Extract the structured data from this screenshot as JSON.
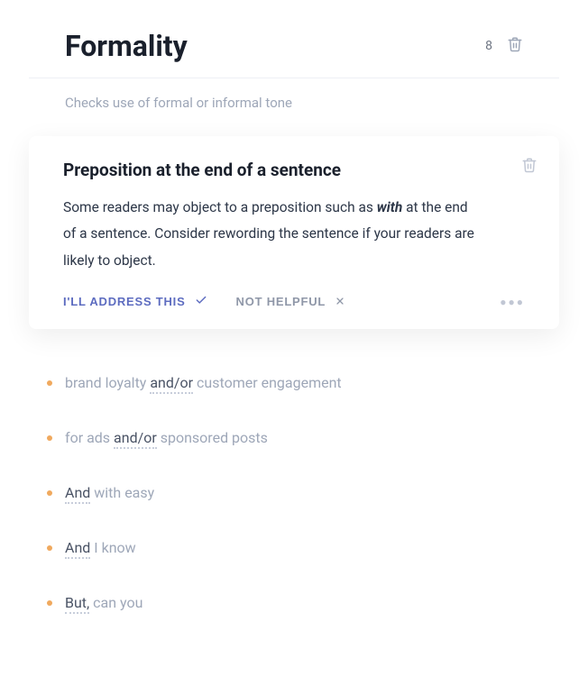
{
  "header": {
    "title": "Formality",
    "count": "8",
    "trash_icon": "trash-icon"
  },
  "subtitle": "Checks use of formal or informal tone",
  "card": {
    "title": "Preposition at the end of a sentence",
    "body_pre": "Some readers may object to a preposition such as ",
    "body_em": "with",
    "body_post": " at the end of a sentence. Consider rewording the sentence if your readers are likely to object.",
    "address_label": "I'll Address This",
    "not_helpful_label": "Not Helpful"
  },
  "items": [
    {
      "pre": "brand loyalty ",
      "hl": "and/or",
      "post": " customer engagement"
    },
    {
      "pre": "for ads ",
      "hl": "and/or",
      "post": " sponsored posts"
    },
    {
      "pre": "",
      "hl": "And",
      "post": " with easy"
    },
    {
      "pre": "",
      "hl": "And",
      "post": " I know"
    },
    {
      "pre": "",
      "hl": "But,",
      "post": " can you"
    }
  ]
}
